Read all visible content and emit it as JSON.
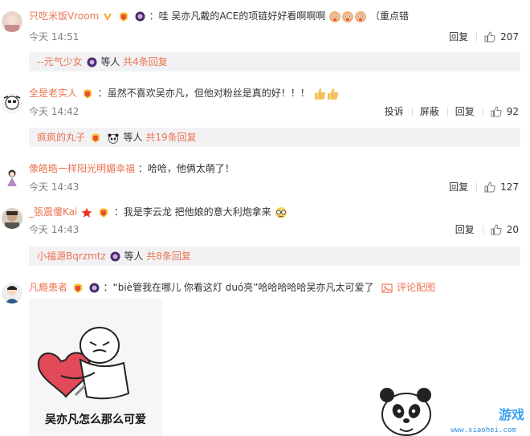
{
  "comments": [
    {
      "username": "只吃米饭Vroom",
      "text": "哇 吴亦凡戴的ACE的项链好好看啊啊啊",
      "text_suffix": "（重点错",
      "time": "今天 14:51",
      "actions": [
        "回复"
      ],
      "likes": "207",
      "reply": {
        "name": "--元气少女",
        "mid": " 等人 ",
        "count": "共4条回复"
      }
    },
    {
      "username": "全是老实人",
      "text": "虽然不喜欢吴亦凡，但他对粉丝是真的好！！！",
      "time": "今天 14:42",
      "actions": [
        "投诉",
        "屏蔽",
        "回复"
      ],
      "likes": "92",
      "reply": {
        "name": "疯疯的丸子",
        "mid": " 等人 ",
        "count": "共19条回复"
      }
    },
    {
      "username": "像皓晧一样阳光明媚幸福",
      "text": "哈哈，他俩太萌了！",
      "time": "今天 14:43",
      "actions": [
        "回复"
      ],
      "likes": "127"
    },
    {
      "username": "_張震僂Kai",
      "text": "我是李云龙 把他娘的意大利炮拿来",
      "time": "今天 14:43",
      "actions": [
        "回复"
      ],
      "likes": "20",
      "reply": {
        "name": "小福源Bqrzmtz",
        "mid": " 等人 ",
        "count": "共8条回复"
      }
    },
    {
      "username": "凡瘾患者",
      "text": "“biè管我在哪儿 你看这灯 duó亮”哈哈哈哈哈吴亦凡太可爱了",
      "image_link": "评论配图",
      "image_caption": "吴亦凡怎么那么可爱"
    }
  ],
  "watermark": {
    "brand": "小黑",
    "sub": "游戏",
    "url": "www.xiaohei.com"
  },
  "colors": {
    "username": "#eb7350",
    "reply_bg": "#f2f2f5",
    "meta": "#808080"
  }
}
